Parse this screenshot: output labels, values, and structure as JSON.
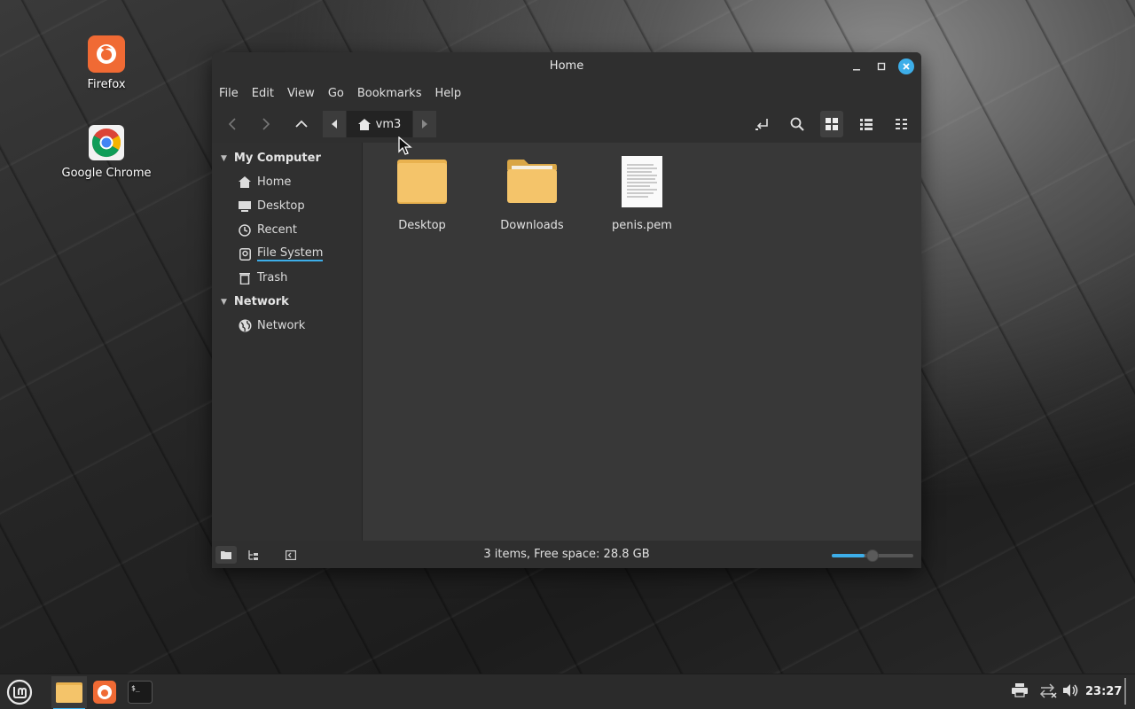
{
  "desktop": {
    "icons": [
      {
        "label": "Firefox"
      },
      {
        "label": "Google Chrome"
      }
    ]
  },
  "window": {
    "title": "Home",
    "menu": [
      "File",
      "Edit",
      "View",
      "Go",
      "Bookmarks",
      "Help"
    ],
    "breadcrumb": {
      "current": "vm3"
    },
    "sidebar": {
      "sections": [
        {
          "header": "My Computer",
          "items": [
            "Home",
            "Desktop",
            "Recent",
            "File System",
            "Trash"
          ]
        },
        {
          "header": "Network",
          "items": [
            "Network"
          ]
        }
      ],
      "selected": "File System"
    },
    "files": [
      {
        "name": "Desktop",
        "type": "folder"
      },
      {
        "name": "Downloads",
        "type": "folder"
      },
      {
        "name": "penis.pem",
        "type": "text-file"
      }
    ],
    "status": "3 items, Free space: 28.8 GB",
    "zoom_level": 0.4
  },
  "taskbar": {
    "clock": "23:27"
  },
  "colors": {
    "accent": "#3daee9",
    "folder": "#f4c46a",
    "firefox": "#f06a34"
  }
}
